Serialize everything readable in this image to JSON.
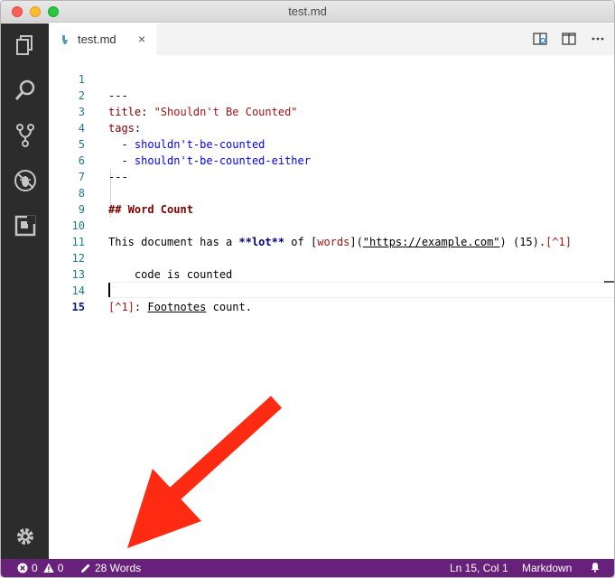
{
  "window": {
    "title": "test.md"
  },
  "tab": {
    "label": "test.md",
    "close": "×"
  },
  "icons": {
    "activity": [
      "explorer-icon",
      "search-icon",
      "source-control-icon",
      "debug-icon",
      "extensions-icon",
      "settings-gear-icon"
    ],
    "tab_actions": [
      "open-preview-side-icon",
      "split-editor-icon",
      "more-actions-icon"
    ],
    "tab_file": "markdown-file-icon",
    "status": [
      "error-icon",
      "warning-icon",
      "pencil-icon",
      "bell-icon"
    ]
  },
  "editor": {
    "line_numbers": [
      "1",
      "2",
      "3",
      "4",
      "5",
      "6",
      "7",
      "8",
      "9",
      "10",
      "11",
      "12",
      "13",
      "14",
      "15"
    ],
    "lines": {
      "l1": "---",
      "l2_key": "title",
      "l2_sep": ": ",
      "l2_val": "\"Shouldn't Be Counted\"",
      "l3_key": "tags",
      "l3_sep": ":",
      "l4_dash": "  - ",
      "l4_val": "shouldn't-be-counted",
      "l5_dash": "  - ",
      "l5_val": "shouldn't-be-counted-either",
      "l6": "---",
      "l8": "## Word Count",
      "l10_a": "This document has a ",
      "l10_bold": "**lot**",
      "l10_b": " of ",
      "l10_lb": "[",
      "l10_link": "words",
      "l10_rb": "](",
      "l10_url": "\"https://example.com\"",
      "l10_c": ") (15).",
      "l10_fn": "[^1]",
      "l12": "    code is counted",
      "l14_fn": "[^1]",
      "l14_colon": ": ",
      "l14_word": "Footnotes",
      "l14_rest": " count."
    }
  },
  "status": {
    "errors": "0",
    "warnings": "0",
    "words": "28 Words",
    "position": "Ln 15, Col 1",
    "language": "Markdown"
  },
  "colors": {
    "status_bar": "#68217a",
    "activity_bar": "#2c2c2c",
    "arrow": "#ff2a12"
  }
}
